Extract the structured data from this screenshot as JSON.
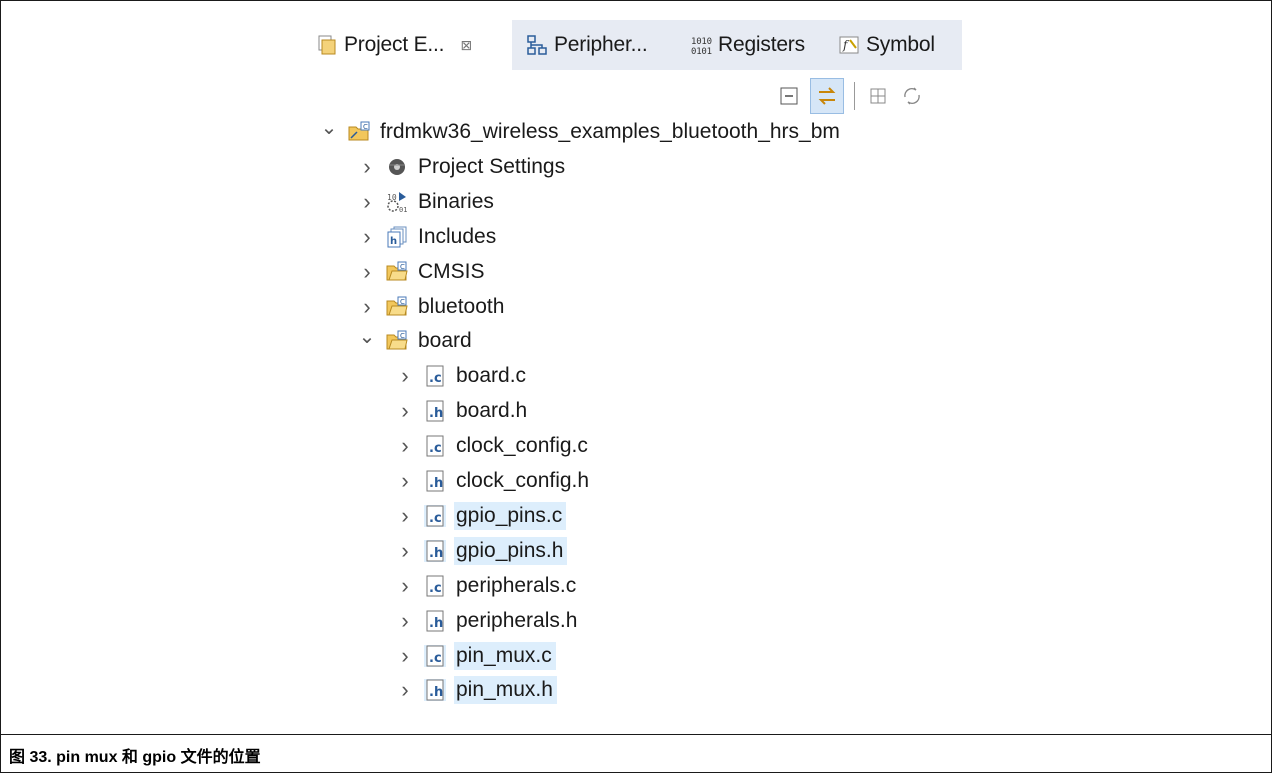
{
  "tabs": [
    {
      "label": "Project E...",
      "icon": "project-explorer-icon",
      "active": true
    },
    {
      "label": "Peripher...",
      "icon": "peripherals-icon"
    },
    {
      "label": "Registers",
      "icon": "registers-icon"
    },
    {
      "label": "Symbol",
      "icon": "symbol-icon"
    }
  ],
  "close_glyph": "⊠",
  "toolbar": [
    {
      "name": "collapse-all-icon"
    },
    {
      "name": "link-with-editor-icon",
      "pressed": true
    },
    {
      "name": "filter-icon"
    },
    {
      "name": "sync-icon"
    }
  ],
  "tree": [
    {
      "label": "frdmkw36_wireless_examples_bluetooth_hrs_bm",
      "icon": "project-folder-icon",
      "chev": "⌄",
      "level": 0
    },
    {
      "label": "Project Settings",
      "icon": "settings-icon",
      "chev": "›",
      "level": 1
    },
    {
      "label": "Binaries",
      "icon": "binaries-icon",
      "chev": "›",
      "level": 1
    },
    {
      "label": "Includes",
      "icon": "includes-icon",
      "chev": "›",
      "level": 1
    },
    {
      "label": "CMSIS",
      "icon": "source-folder-icon",
      "chev": "›",
      "level": 1
    },
    {
      "label": "bluetooth",
      "icon": "source-folder-icon",
      "chev": "›",
      "level": 1
    },
    {
      "label": "board",
      "icon": "source-folder-icon",
      "chev": "⌄",
      "level": 1
    },
    {
      "label": "board.c",
      "icon": "c-file-icon",
      "chev": "›",
      "level": 2
    },
    {
      "label": "board.h",
      "icon": "h-file-icon",
      "chev": "›",
      "level": 2
    },
    {
      "label": "clock_config.c",
      "icon": "c-file-icon",
      "chev": "›",
      "level": 2
    },
    {
      "label": "clock_config.h",
      "icon": "h-file-icon",
      "chev": "›",
      "level": 2
    },
    {
      "label": "gpio_pins.c",
      "icon": "c-file-icon",
      "chev": "›",
      "level": 2,
      "selected": true
    },
    {
      "label": "gpio_pins.h",
      "icon": "h-file-icon",
      "chev": "›",
      "level": 2,
      "selected": true
    },
    {
      "label": "peripherals.c",
      "icon": "c-file-icon",
      "chev": "›",
      "level": 2
    },
    {
      "label": "peripherals.h",
      "icon": "h-file-icon",
      "chev": "›",
      "level": 2
    },
    {
      "label": "pin_mux.c",
      "icon": "c-file-icon",
      "chev": "›",
      "level": 2,
      "selected": true
    },
    {
      "label": "pin_mux.h",
      "icon": "h-file-icon",
      "chev": "›",
      "level": 2,
      "selected": true
    }
  ],
  "caption": "图 33. pin mux 和 gpio 文件的位置",
  "colors": {
    "selection": "#ddeefc",
    "tab_inactive": "#e7ebf3",
    "folder": "#f2c75c"
  }
}
